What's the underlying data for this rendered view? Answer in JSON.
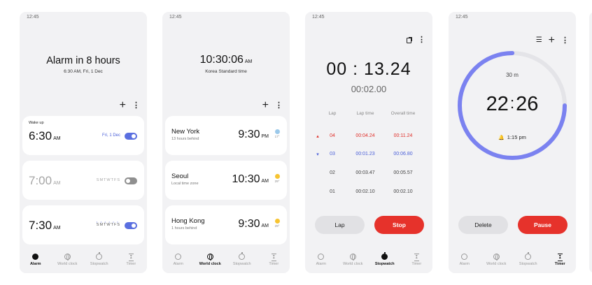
{
  "status_time": "12:45",
  "nav": [
    {
      "id": "alarm",
      "label": "Alarm"
    },
    {
      "id": "world",
      "label": "World clock"
    },
    {
      "id": "stopwatch",
      "label": "Stopwatch"
    },
    {
      "id": "timer",
      "label": "Timer"
    }
  ],
  "alarm": {
    "title": "Alarm in 8 hours",
    "subtitle": "6:30 AM, Fri, 1 Dec",
    "items": [
      {
        "label": "Wake up",
        "time": "6:30",
        "ampm": "AM",
        "date": "Fri, 1 Dec",
        "days": "",
        "on": true
      },
      {
        "label": "",
        "time": "7:00",
        "ampm": "AM",
        "date": "",
        "days": "SMTWTFS",
        "on": false
      },
      {
        "label": "",
        "time": "7:30",
        "ampm": "AM",
        "date": "",
        "days": "SMTWTFS",
        "on": true
      }
    ],
    "day_dots": "••••••"
  },
  "world": {
    "time": "10:30:06",
    "ampm": "AM",
    "zone": "Korea Standard time",
    "cities": [
      {
        "name": "New York",
        "sub": "13 hours behind",
        "time": "9:30",
        "ampm": "PM",
        "temp": "17°",
        "icon": "cloudy-icon"
      },
      {
        "name": "Seoul",
        "sub": "Local time zone",
        "time": "10:30",
        "ampm": "AM",
        "temp": "29°",
        "icon": "sun-icon"
      },
      {
        "name": "Hong Kong",
        "sub": "1 hours behind",
        "time": "9:30",
        "ampm": "AM",
        "temp": "29°",
        "icon": "sun-icon"
      }
    ]
  },
  "stopwatch": {
    "main_min": "00",
    "main_sec": "13.24",
    "sub": "00:02.00",
    "headers": {
      "lap": "Lap",
      "lap_time": "Lap time",
      "overall": "Overall time"
    },
    "laps": [
      {
        "mark": "▴",
        "lap": "04",
        "lap_time": "00:04.24",
        "overall": "00:11.24",
        "tone": "red"
      },
      {
        "mark": "▾",
        "lap": "03",
        "lap_time": "00:01.23",
        "overall": "00:06.80",
        "tone": "blue"
      },
      {
        "mark": "",
        "lap": "02",
        "lap_time": "00:03.47",
        "overall": "00:05.57",
        "tone": "gray"
      },
      {
        "mark": "",
        "lap": "01",
        "lap_time": "00:02.10",
        "overall": "00:02.10",
        "tone": "gray"
      }
    ],
    "lap_btn": "Lap",
    "stop_btn": "Stop"
  },
  "timer": {
    "duration": "30 m",
    "main_min": "22",
    "main_sec": "26",
    "end_time": "1:15 pm",
    "progress_remaining": 0.75,
    "delete_btn": "Delete",
    "pause_btn": "Pause"
  },
  "colors": {
    "accent_blue": "#5a6fe0",
    "accent_red": "#e6322b",
    "ring_track": "#e4e4e8"
  }
}
